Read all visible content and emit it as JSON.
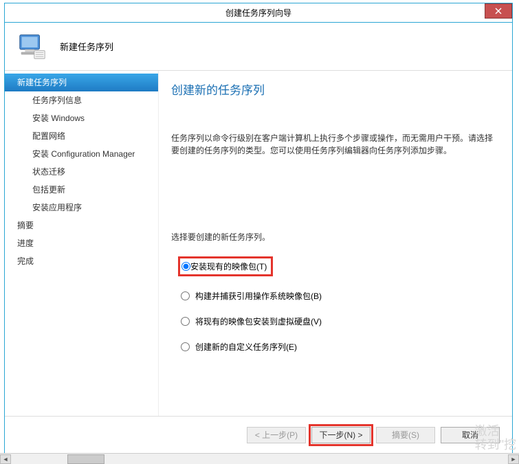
{
  "titlebar": {
    "title": "创建任务序列向导"
  },
  "header": {
    "title": "新建任务序列"
  },
  "sidebar": {
    "items": [
      {
        "label": "新建任务序列",
        "level": 0,
        "selected": true
      },
      {
        "label": "任务序列信息",
        "level": 1,
        "selected": false
      },
      {
        "label": "安装 Windows",
        "level": 1,
        "selected": false
      },
      {
        "label": "配置网络",
        "level": 1,
        "selected": false
      },
      {
        "label": "安装 Configuration Manager",
        "level": 1,
        "selected": false
      },
      {
        "label": "状态迁移",
        "level": 1,
        "selected": false
      },
      {
        "label": "包括更新",
        "level": 1,
        "selected": false
      },
      {
        "label": "安装应用程序",
        "level": 1,
        "selected": false
      },
      {
        "label": "摘要",
        "level": 0,
        "selected": false
      },
      {
        "label": "进度",
        "level": 0,
        "selected": false
      },
      {
        "label": "完成",
        "level": 0,
        "selected": false
      }
    ]
  },
  "content": {
    "title": "创建新的任务序列",
    "description": "任务序列以命令行级别在客户端计算机上执行多个步骤或操作，而无需用户干预。请选择要创建的任务序列的类型。您可以使用任务序列编辑器向任务序列添加步骤。",
    "prompt": "选择要创建的新任务序列。",
    "options": [
      {
        "label": "安装现有的映像包(T)",
        "value": "install_existing",
        "checked": true,
        "highlighted": true
      },
      {
        "label": "构建并捕获引用操作系统映像包(B)",
        "value": "build_capture",
        "checked": false,
        "highlighted": false
      },
      {
        "label": "将现有的映像包安装到虚拟硬盘(V)",
        "value": "install_vhd",
        "checked": false,
        "highlighted": false
      },
      {
        "label": "创建新的自定义任务序列(E)",
        "value": "custom",
        "checked": false,
        "highlighted": false
      }
    ]
  },
  "footer": {
    "prev": "< 上一步(P)",
    "next": "下一步(N) >",
    "summary": "摘要(S)",
    "cancel": "取消"
  },
  "watermark": {
    "line1": "激活",
    "line2": "转到\"挖"
  }
}
